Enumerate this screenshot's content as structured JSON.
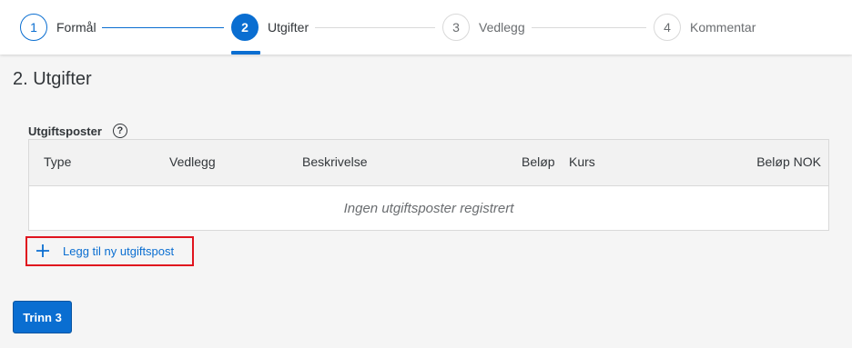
{
  "wizard": {
    "steps": [
      {
        "number": "1",
        "label": "Formål",
        "state": "done"
      },
      {
        "number": "2",
        "label": "Utgifter",
        "state": "active"
      },
      {
        "number": "3",
        "label": "Vedlegg",
        "state": "future"
      },
      {
        "number": "4",
        "label": "Kommentar",
        "state": "future"
      }
    ]
  },
  "page": {
    "title": "2. Utgifter"
  },
  "expenses": {
    "label": "Utgiftsposter",
    "help_icon": "?",
    "columns": [
      "Type",
      "Vedlegg",
      "Beskrivelse",
      "Beløp",
      "Kurs",
      "Beløp NOK"
    ],
    "empty_text": "Ingen utgiftsposter registrert",
    "add_label": "Legg til ny utgiftspost",
    "add_icon": "plus-icon"
  },
  "footer": {
    "next_label": "Trinn 3"
  },
  "colors": {
    "accent": "#0a6ed1",
    "highlight_border": "#e0141e"
  }
}
